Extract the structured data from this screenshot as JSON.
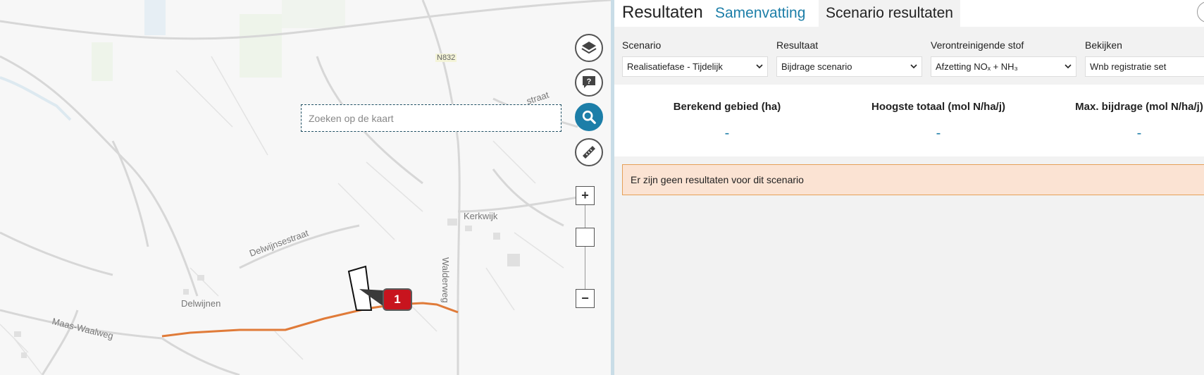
{
  "map": {
    "search_placeholder": "Zoeken op de kaart",
    "labels": {
      "road_n832": "N832",
      "kerkwijk": "Kerkwijk",
      "delwijnsestraat": "Delwijnsestraat",
      "delwijnen": "Delwijnen",
      "maas_waalweg": "Maas-Waalweg",
      "walderweg": "Walderweg",
      "straat": "straat"
    },
    "marker_number": "1",
    "buttons": {
      "layers": "layers-icon",
      "help": "help-icon",
      "search": "search-icon",
      "measure": "ruler-icon",
      "zoom_in": "+",
      "zoom_out": "−"
    },
    "colors": {
      "route": "#e07b39",
      "marker": "#c8141e",
      "accent": "#1c7ea8"
    }
  },
  "panel": {
    "title": "Resultaten",
    "tabs": [
      {
        "label": "Samenvatting",
        "active": false
      },
      {
        "label": "Scenario resultaten",
        "active": true
      }
    ],
    "filters": [
      {
        "label": "Scenario",
        "value": "Realisatiefase - Tijdelijk"
      },
      {
        "label": "Resultaat",
        "value": "Bijdrage scenario"
      },
      {
        "label": "Verontreinigende stof",
        "value": "Afzetting NOₓ + NH₃"
      },
      {
        "label": "Bekijken",
        "value": "Wnb registratie set"
      }
    ],
    "stats": [
      {
        "label": "Berekend gebied (ha)",
        "value": "-"
      },
      {
        "label": "Hoogste totaal (mol N/ha/j)",
        "value": "-"
      },
      {
        "label": "Max. bijdrage (mol N/ha/j)",
        "value": "-"
      }
    ],
    "notice": "Er zijn geen resultaten voor dit scenario"
  }
}
